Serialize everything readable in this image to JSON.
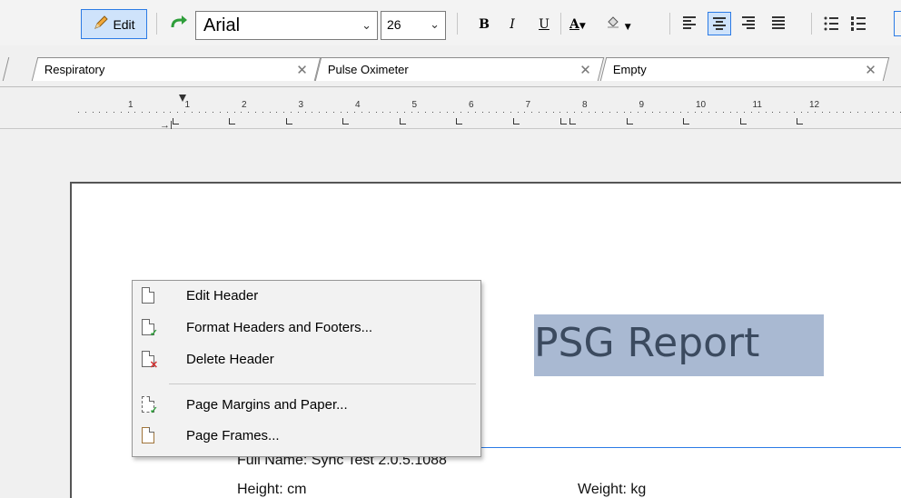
{
  "toolbar": {
    "edit_label": "Edit",
    "font_value": "Arial",
    "size_value": "26",
    "bold_label": "B",
    "italic_label": "I",
    "underline_label": "U",
    "font_color_label": "A"
  },
  "tabs": [
    {
      "label": "Respiratory",
      "close": "✕"
    },
    {
      "label": "Pulse Oximeter",
      "close": "✕"
    },
    {
      "label": "Empty",
      "close": "✕"
    }
  ],
  "ruler": {
    "numbers": [
      "1",
      "1",
      "2",
      "3",
      "4",
      "5",
      "6",
      "7",
      "8",
      "9",
      "10",
      "11",
      "12"
    ]
  },
  "document": {
    "title": "PSG Report",
    "full_name": "Full Name: Sync Test 2.0.5.1088",
    "height": "Height:  cm",
    "weight": "Weight:  kg"
  },
  "context_menu": {
    "items": [
      {
        "label": "Edit Header",
        "icon": "document-icon"
      },
      {
        "label": "Format Headers and Footers...",
        "icon": "format-document-icon"
      },
      {
        "label": "Delete Header",
        "icon": "delete-document-icon"
      },
      {
        "label": "Page Margins and Paper...",
        "icon": "page-margins-icon"
      },
      {
        "label": "Page Frames...",
        "icon": "page-frame-icon"
      }
    ]
  },
  "colors": {
    "accent": "#2c7be5",
    "selection": "#a9b9d2"
  }
}
